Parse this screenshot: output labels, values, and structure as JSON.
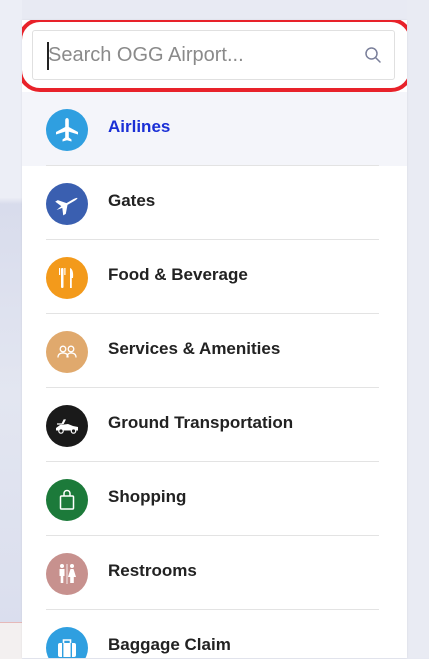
{
  "search": {
    "placeholder": "Search OGG Airport..."
  },
  "categories": [
    {
      "label": "Airlines",
      "icon": "airplane-icon",
      "color": "#2f9fe0",
      "active": true
    },
    {
      "label": "Gates",
      "icon": "gate-plane-icon",
      "color": "#3a5fb0"
    },
    {
      "label": "Food & Beverage",
      "icon": "fork-knife-icon",
      "color": "#f39a1b"
    },
    {
      "label": "Services & Amenities",
      "icon": "people-icon",
      "color": "#e0a96d"
    },
    {
      "label": "Ground Transportation",
      "icon": "car-icon",
      "color": "#1a1a1a"
    },
    {
      "label": "Shopping",
      "icon": "shopping-bag-icon",
      "color": "#1c7a3a"
    },
    {
      "label": "Restrooms",
      "icon": "restroom-icon",
      "color": "#c7918e"
    },
    {
      "label": "Baggage Claim",
      "icon": "luggage-icon",
      "color": "#2f9fe0"
    }
  ],
  "colors": {
    "active_text": "#1a2fd6",
    "highlight": "#e8222a"
  }
}
